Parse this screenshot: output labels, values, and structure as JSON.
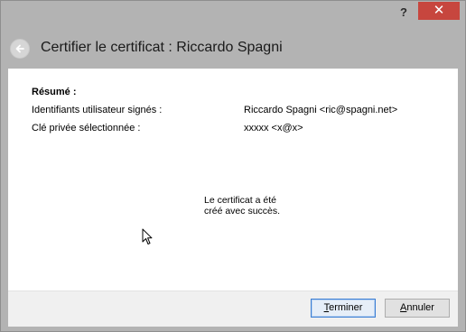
{
  "titlebar": {
    "help_label": "?",
    "close_label": "✕"
  },
  "header": {
    "title": "Certifier le certificat : Riccardo Spagni"
  },
  "summary": {
    "heading": "Résumé :",
    "rows": [
      {
        "label": "Identifiants utilisateur signés :",
        "value": "Riccardo Spagni <ric@spagni.net>"
      },
      {
        "label": "Clé privée sélectionnée :",
        "value": "xxxxx <x@x>"
      }
    ]
  },
  "message": {
    "line1": "Le certificat a été",
    "line2": "créé avec succès."
  },
  "buttons": {
    "finish_mnemonic": "T",
    "finish_rest": "erminer",
    "cancel_mnemonic": "A",
    "cancel_rest": "nnuler"
  },
  "colors": {
    "close_button": "#c7463e",
    "chrome": "#b3b3b3",
    "default_button_border": "#3b7ed4"
  },
  "icons": {
    "back": "back-arrow-icon",
    "cursor": "mouse-cursor-icon"
  }
}
